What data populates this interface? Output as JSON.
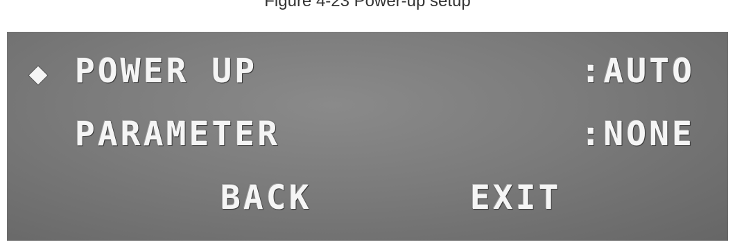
{
  "caption": "Figure 4-23 Power-up setup",
  "osd_menu": {
    "cursor_icon": "diamond-cursor-icon",
    "rows": [
      {
        "label": "POWER UP",
        "value": ":AUTO"
      },
      {
        "label": "PARAMETER",
        "value": ":NONE"
      }
    ],
    "back_label": "BACK",
    "exit_label": "EXIT"
  }
}
